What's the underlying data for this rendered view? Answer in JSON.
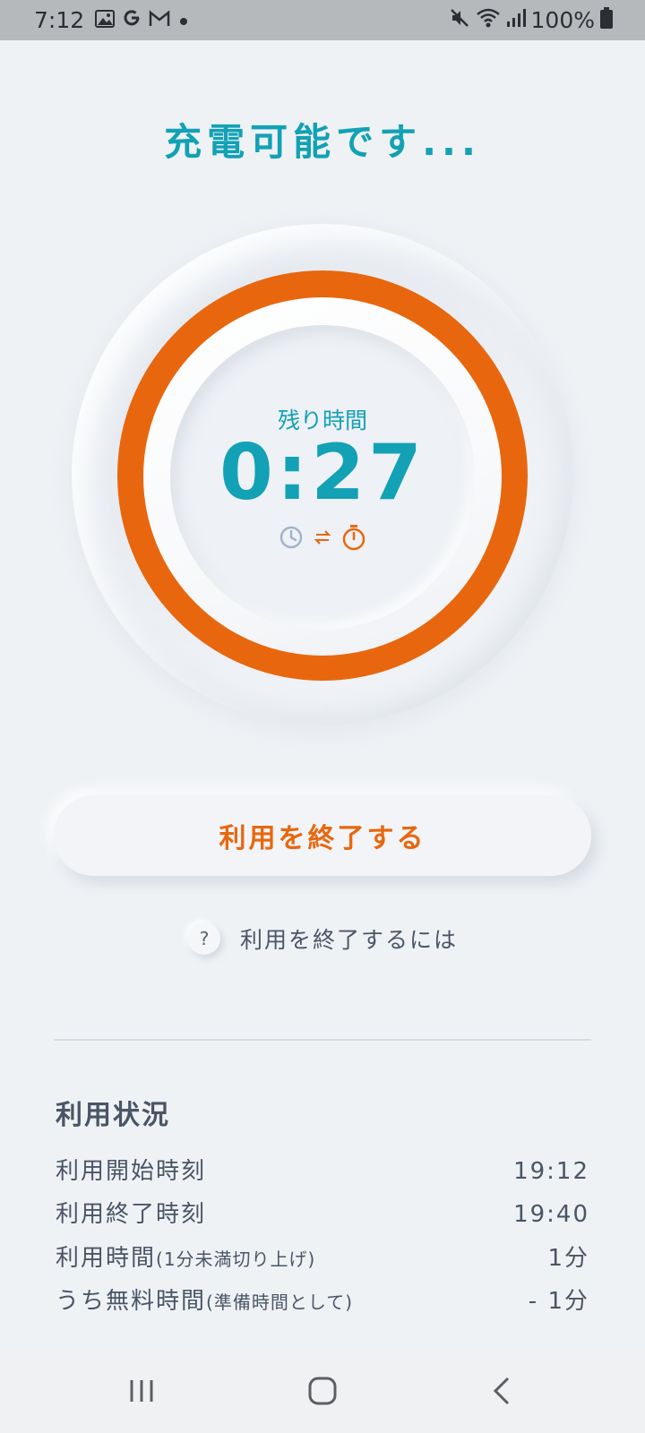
{
  "status_bar": {
    "time": "7:12",
    "battery": "100%",
    "left_icons": [
      "image-icon",
      "google-icon",
      "gmail-icon",
      "dot-icon"
    ],
    "right_icons": [
      "mute-icon",
      "wifi-icon",
      "signal-icon",
      "battery-icon"
    ]
  },
  "title": "充電可能です...",
  "dial": {
    "label": "残り時間",
    "time": "0:27",
    "ring_color": "#e8670e",
    "ring_fill_fraction": 1.0,
    "icons": [
      "clock-icon",
      "swap-arrows-icon",
      "stopwatch-icon"
    ]
  },
  "end_button_label": "利用を終了する",
  "help": {
    "icon_text": "?",
    "label": "利用を終了するには"
  },
  "usage": {
    "heading": "利用状況",
    "rows": [
      {
        "label": "利用開始時刻",
        "note": "",
        "value": "19:12"
      },
      {
        "label": "利用終了時刻",
        "note": "",
        "value": "19:40"
      },
      {
        "label": "利用時間",
        "note": "(1分未満切り上げ)",
        "value": "1分"
      },
      {
        "label": "うち無料時間",
        "note": "(準備時間として)",
        "value": "- 1分"
      }
    ]
  },
  "nav": [
    "recent-apps-icon",
    "home-icon",
    "back-icon"
  ],
  "colors": {
    "accent_teal": "#12a1b5",
    "accent_orange": "#e8670e",
    "background": "#eff2f5",
    "text": "#4a5566"
  }
}
